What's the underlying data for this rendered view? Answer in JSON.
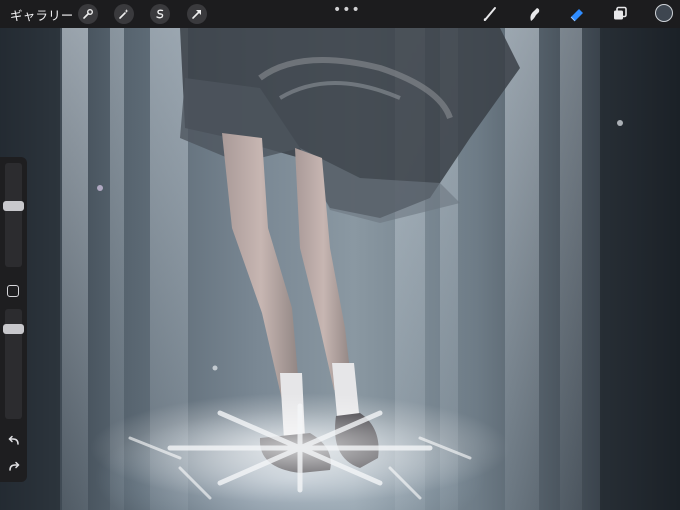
{
  "topbar": {
    "gallery_label": "ギャラリー",
    "left_tools": [
      {
        "name": "actions",
        "icon": "wrench-icon"
      },
      {
        "name": "adjustments",
        "icon": "magic-wand-icon"
      },
      {
        "name": "selection",
        "icon": "selection-s-icon"
      },
      {
        "name": "transform",
        "icon": "arrow-cursor-icon"
      }
    ],
    "more_label": "•••",
    "right_tools": [
      {
        "name": "brush",
        "icon": "brush-icon",
        "active": false
      },
      {
        "name": "smudge",
        "icon": "smudge-icon",
        "active": false
      },
      {
        "name": "eraser",
        "icon": "eraser-icon",
        "active": true
      },
      {
        "name": "layers",
        "icon": "layers-icon",
        "active": false
      }
    ],
    "current_color": "#3e4650",
    "accent_color": "#2f8cff"
  },
  "sidebar": {
    "brush_size_level": 0.6,
    "opacity_level": 0.85,
    "modify_button": "square-icon",
    "undo": "undo-icon",
    "redo": "redo-icon"
  }
}
